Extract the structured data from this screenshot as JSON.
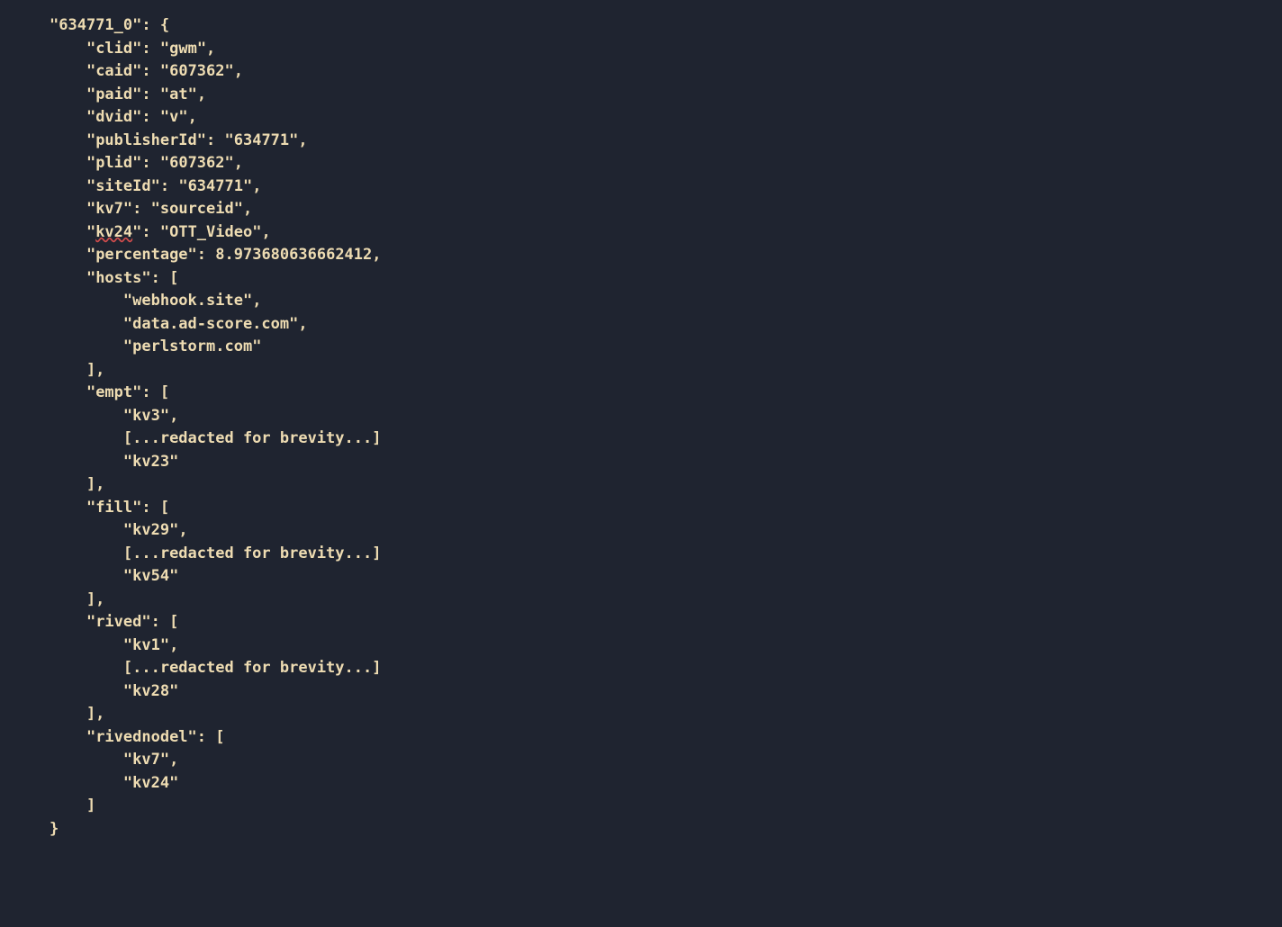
{
  "code": {
    "object_key": "634771_0",
    "clid_key": "clid",
    "clid_val": "gwm",
    "caid_key": "caid",
    "caid_val": "607362",
    "paid_key": "paid",
    "paid_val": "at",
    "dvid_key": "dvid",
    "dvid_val": "v",
    "publisherId_key": "publisherId",
    "publisherId_val": "634771",
    "plid_key": "plid",
    "plid_val": "607362",
    "siteId_key": "siteId",
    "siteId_val": "634771",
    "kv7_key": "kv7",
    "kv7_val": "sourceid",
    "kv24_key": "kv24",
    "kv24_val": "OTT_Video",
    "percentage_key": "percentage",
    "percentage_val": "8.973680636662412",
    "hosts_key": "hosts",
    "hosts_0": "webhook.site",
    "hosts_1": "data.ad-score.com",
    "hosts_2": "perlstorm.com",
    "empt_key": "empt",
    "empt_0": "kv3",
    "redacted": "[...redacted for brevity...]",
    "empt_2": "kv23",
    "fill_key": "fill",
    "fill_0": "kv29",
    "fill_2": "kv54",
    "rived_key": "rived",
    "rived_0": "kv1",
    "rived_2": "kv28",
    "rivednodel_key": "rivednodel",
    "rivednodel_0": "kv7",
    "rivednodel_1": "kv24"
  }
}
